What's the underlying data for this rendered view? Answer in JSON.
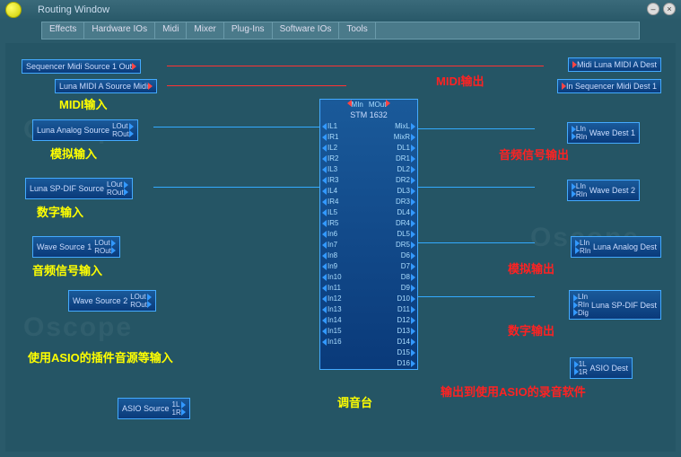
{
  "window": {
    "title": "Routing Window"
  },
  "toolbar": [
    "Effects",
    "Hardware IOs",
    "Midi",
    "Mixer",
    "Plug-Ins",
    "Software IOs",
    "Tools"
  ],
  "sources": {
    "seqMidi": {
      "name": "Sequencer Midi Source 1",
      "pin": "Out"
    },
    "lunaMidi": {
      "name": "Luna MIDI A Source",
      "pin": "Midi"
    },
    "lunaAnalog": {
      "name": "Luna Analog Source",
      "pins": [
        "LOut",
        "ROut"
      ]
    },
    "lunaSpdif": {
      "name": "Luna SP-DIF Source",
      "pins": [
        "LOut",
        "ROut"
      ]
    },
    "wave1": {
      "name": "Wave Source 1",
      "pins": [
        "LOut",
        "ROut"
      ]
    },
    "wave2": {
      "name": "Wave Source 2",
      "pins": [
        "LOut",
        "ROut"
      ]
    },
    "asio": {
      "name": "ASIO Source",
      "pins": [
        "1L",
        "1R"
      ]
    }
  },
  "dests": {
    "midiLuna": {
      "name": "Midi Luna MIDI A Dest"
    },
    "seqMidiDest": {
      "name": "In Sequencer Midi Dest 1"
    },
    "waveDest1": {
      "name": "Wave Dest 1",
      "pins": [
        "LIn",
        "RIn"
      ]
    },
    "waveDest2": {
      "name": "Wave Dest 2",
      "pins": [
        "LIn",
        "RIn"
      ]
    },
    "lunaAnalog": {
      "name": "Luna Analog Dest",
      "pins": [
        "LIn",
        "RIn"
      ]
    },
    "lunaSpdif": {
      "name": "Luna SP-DIF Dest",
      "pins": [
        "LIn",
        "RIn",
        "Dig"
      ]
    },
    "asio": {
      "name": "ASIO Dest",
      "pins": [
        "1L",
        "1R"
      ]
    }
  },
  "mixer": {
    "topIn": "MIn",
    "topOut": "MOut",
    "title": "STM 1632",
    "mix": [
      "MixL",
      "MixR"
    ],
    "left": [
      "IL1",
      "IR1",
      "IL2",
      "IR2",
      "IL3",
      "IR3",
      "IL4",
      "IR4",
      "IL5",
      "IR5",
      "In6",
      "In7",
      "In8",
      "In9",
      "In10",
      "In11",
      "In12",
      "In13",
      "In14",
      "In15",
      "In16"
    ],
    "right": [
      "DL1",
      "DR1",
      "DL2",
      "DR2",
      "DL3",
      "DR3",
      "DL4",
      "DR4",
      "DL5",
      "DR5",
      "D6",
      "D7",
      "D8",
      "D9",
      "D10",
      "D11",
      "D12",
      "D13",
      "D14",
      "D15",
      "D16"
    ]
  },
  "labels": {
    "midiIn": "MIDI输入",
    "midiOut": "MIDI输出",
    "analogIn": "模拟输入",
    "digitalIn": "数字输入",
    "audioIn": "音频信号输入",
    "asioIn": "使用ASIO的插件音源等输入",
    "mixerLbl": "调音台",
    "audioOut": "音频信号输出",
    "analogOut": "模拟输出",
    "digitalOut": "数字输出",
    "asioOut": "输出到使用ASIO的录音软件"
  },
  "watermark": "Oscope"
}
